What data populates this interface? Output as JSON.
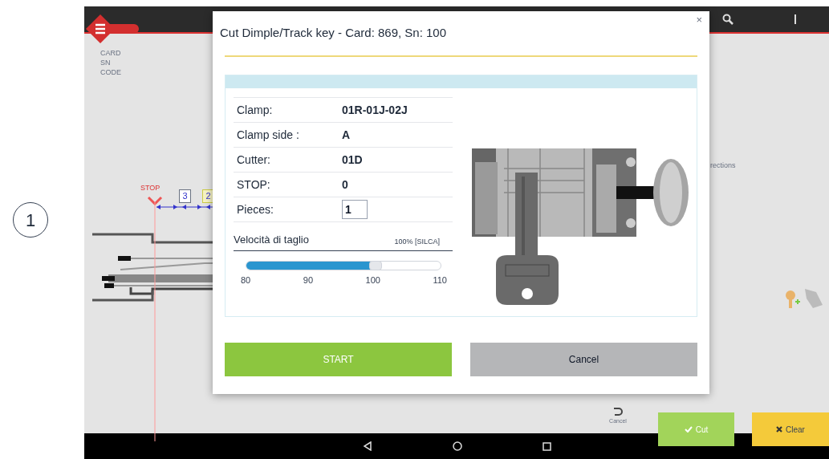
{
  "step_marker": "1",
  "background": {
    "info_labels": [
      "CARD",
      "SN",
      "CODE"
    ],
    "stop_label": "STOP",
    "position_labels": [
      "3",
      "2"
    ],
    "side_text": "rections",
    "cancel_label": "Cancel",
    "cut_button": "Cut",
    "clear_button": "Clear"
  },
  "dialog": {
    "title": "Cut Dimple/Track key - Card: 869, Sn: 100",
    "close": "×",
    "rows": [
      {
        "kind": "text",
        "label": "Clamp:",
        "value": "01R-01J-02J"
      },
      {
        "kind": "text",
        "label": "Clamp side :",
        "value": "A"
      },
      {
        "kind": "text",
        "label": "Cutter:",
        "value": "01D"
      },
      {
        "kind": "text",
        "label": "STOP:",
        "value": "0"
      },
      {
        "kind": "input",
        "label": "Pieces:",
        "value": "1"
      }
    ],
    "speed": {
      "label": "Velocità di taglio",
      "reading": "100% [SILCA]",
      "level": 0.667,
      "ticks": [
        "80",
        "90",
        "100",
        "110"
      ]
    },
    "buttons": [
      {
        "kind": "primary",
        "label": "START"
      },
      {
        "kind": "secondary",
        "label": "Cancel"
      }
    ]
  }
}
